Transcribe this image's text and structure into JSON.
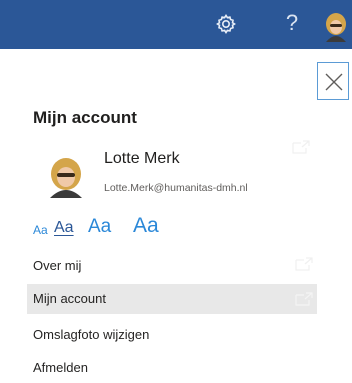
{
  "topbar": {
    "background": "#2b5797",
    "icons": [
      "gear-icon",
      "help-icon",
      "avatar"
    ],
    "help_label": "?"
  },
  "panel": {
    "title": "Mijn account",
    "close_icon": "close-icon",
    "user": {
      "name": "Lotte Merk",
      "email": "Lotte.Merk@humanitas-dmh.nl"
    },
    "font_sizes": [
      {
        "label": "Aa",
        "selected": false
      },
      {
        "label": "Aa",
        "selected": true
      },
      {
        "label": "Aa",
        "selected": false
      },
      {
        "label": "Aa",
        "selected": false
      }
    ],
    "menu": [
      {
        "label": "Over mij"
      },
      {
        "label": "Mijn account"
      },
      {
        "label": "Omslagfoto wijzigen"
      },
      {
        "label": "Afmelden"
      }
    ],
    "accent_color": "#2b88d8",
    "active_item_bg": "#e8e8e8"
  }
}
